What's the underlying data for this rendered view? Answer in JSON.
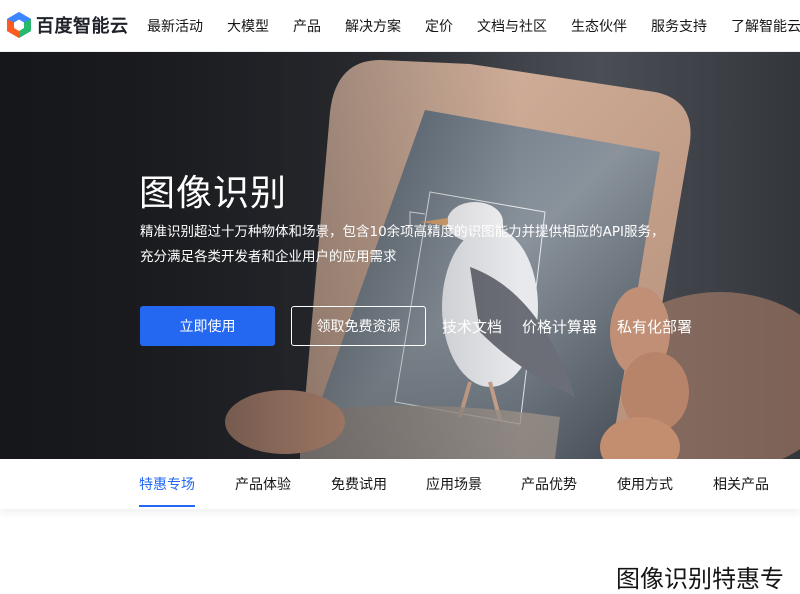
{
  "header": {
    "logo_text": "百度智能云",
    "nav": [
      "最新活动",
      "大模型",
      "产品",
      "解决方案",
      "定价",
      "文档与社区",
      "生态伙伴",
      "服务支持",
      "了解智能云"
    ]
  },
  "hero": {
    "title": "图像识别",
    "description": "精准识别超过十万种物体和场景，包含10余项高精度的识图能力并提供相应的API服务，\n充分满足各类开发者和企业用户的应用需求",
    "primary_button": "立即使用",
    "secondary_button": "领取免费资源",
    "links": [
      "技术文档",
      "价格计算器",
      "私有化部署"
    ]
  },
  "subnav": {
    "tabs": [
      "特惠专场",
      "产品体验",
      "免费试用",
      "应用场景",
      "产品优势",
      "使用方式",
      "相关产品"
    ],
    "active_index": 0
  },
  "section": {
    "title": "图像识别特惠专"
  },
  "colors": {
    "accent": "#2468f2",
    "hero_background": "#25272c",
    "text": "#151515"
  }
}
